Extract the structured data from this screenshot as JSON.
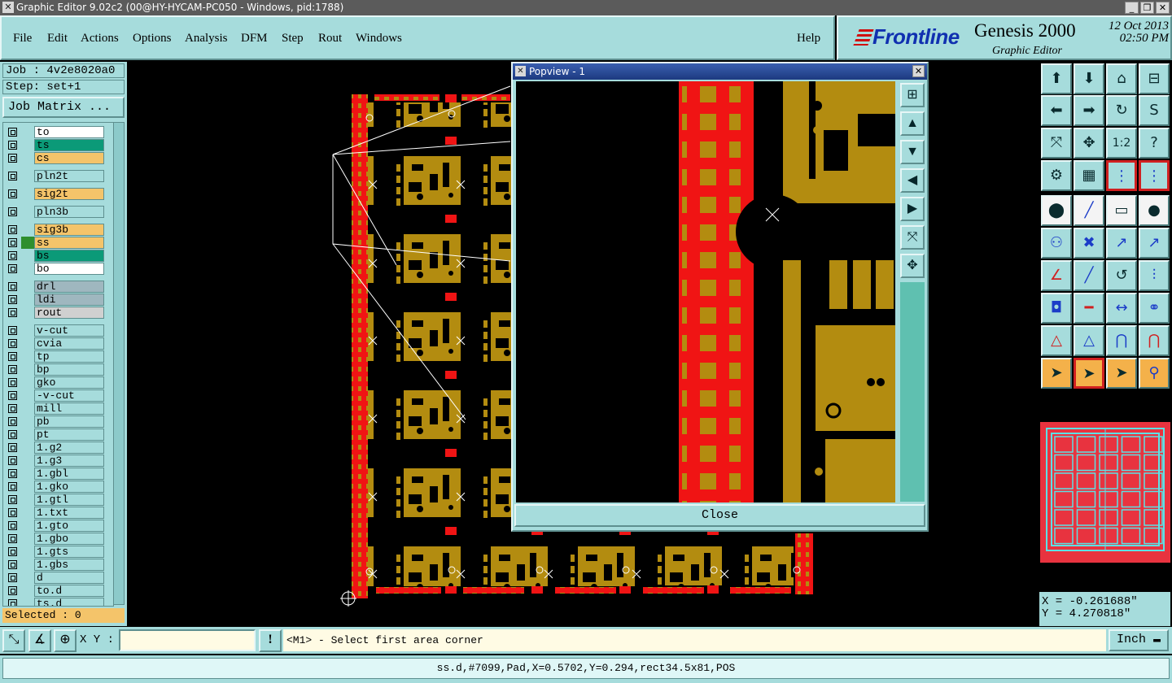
{
  "window": {
    "title": "Graphic Editor 9.02c2 (00@HY-HYCAM-PC050 - Windows, pid:1788)",
    "buttons": [
      "_",
      "❐",
      "✕"
    ]
  },
  "menubar": {
    "items": [
      "File",
      "Edit",
      "Actions",
      "Options",
      "Analysis",
      "DFM",
      "Step",
      "Rout",
      "Windows"
    ],
    "help": "Help"
  },
  "branding": {
    "logo": "Frontline",
    "product": "Genesis 2000",
    "subtitle": "Graphic Editor",
    "date": "12 Oct 2013",
    "time": "02:50 PM"
  },
  "left_panel": {
    "job": "Job : 4v2e8020a0",
    "step": "Step: set+1",
    "job_matrix_button": "Job Matrix ...",
    "selected": "Selected : 0",
    "layers": [
      {
        "name": "to",
        "color": "#ffffff",
        "box": ""
      },
      {
        "name": "ts",
        "color": "#0b9a78",
        "box": ""
      },
      {
        "name": "cs",
        "color": "#f4c46a",
        "box": ""
      },
      {
        "name": "pln2t",
        "color": "#a6dcdc",
        "box": ""
      },
      {
        "name": "sig2t",
        "color": "#f4c46a",
        "box": ""
      },
      {
        "name": "pln3b",
        "color": "#a6dcdc",
        "box": ""
      },
      {
        "name": "sig3b",
        "color": "#f4c46a",
        "box": ""
      },
      {
        "name": "ss",
        "color": "#f4c46a",
        "box": "#2e8f2e"
      },
      {
        "name": "bs",
        "color": "#0b9a78",
        "box": ""
      },
      {
        "name": "bo",
        "color": "#ffffff",
        "box": ""
      },
      {
        "name": "drl",
        "color": "#9fb7bf",
        "box": ""
      },
      {
        "name": "ldi",
        "color": "#9fb7bf",
        "box": ""
      },
      {
        "name": "rout",
        "color": "#d0d0d0",
        "box": ""
      },
      {
        "name": "v-cut",
        "color": "#a6dcdc",
        "box": ""
      },
      {
        "name": "cvia",
        "color": "#a6dcdc",
        "box": ""
      },
      {
        "name": "tp",
        "color": "#a6dcdc",
        "box": ""
      },
      {
        "name": "bp",
        "color": "#a6dcdc",
        "box": ""
      },
      {
        "name": "gko",
        "color": "#a6dcdc",
        "box": ""
      },
      {
        "name": "-v-cut",
        "color": "#a6dcdc",
        "box": ""
      },
      {
        "name": "mill",
        "color": "#a6dcdc",
        "box": ""
      },
      {
        "name": "pb",
        "color": "#a6dcdc",
        "box": ""
      },
      {
        "name": "pt",
        "color": "#a6dcdc",
        "box": ""
      },
      {
        "name": "1.g2",
        "color": "#a6dcdc",
        "box": ""
      },
      {
        "name": "1.g3",
        "color": "#a6dcdc",
        "box": ""
      },
      {
        "name": "1.gbl",
        "color": "#a6dcdc",
        "box": ""
      },
      {
        "name": "1.gko",
        "color": "#a6dcdc",
        "box": ""
      },
      {
        "name": "1.gtl",
        "color": "#a6dcdc",
        "box": ""
      },
      {
        "name": "1.txt",
        "color": "#a6dcdc",
        "box": ""
      },
      {
        "name": "1.gto",
        "color": "#a6dcdc",
        "box": ""
      },
      {
        "name": "1.gbo",
        "color": "#a6dcdc",
        "box": ""
      },
      {
        "name": "1.gts",
        "color": "#a6dcdc",
        "box": ""
      },
      {
        "name": "1.gbs",
        "color": "#a6dcdc",
        "box": ""
      },
      {
        "name": "d",
        "color": "#a6dcdc",
        "box": ""
      },
      {
        "name": "to.d",
        "color": "#a6dcdc",
        "box": ""
      },
      {
        "name": "ts.d",
        "color": "#a6dcdc",
        "box": ""
      }
    ]
  },
  "popview": {
    "title": "Popview - 1",
    "close_button": "Close"
  },
  "toolbox": {
    "coords_x": "X = -0.261688\"",
    "coords_y": "Y = 4.270818\""
  },
  "bottom": {
    "xy_label": "X Y :",
    "xy_value": "",
    "message": "<M1> - Select first area corner",
    "unit": "Inch",
    "status": "ss.d,#7099,Pad,X=0.5702,Y=0.294,rect34.5x81,POS"
  },
  "colors": {
    "panel": "#a6dcdc",
    "copper": "#b38c10",
    "solder_red": "#f01414"
  }
}
